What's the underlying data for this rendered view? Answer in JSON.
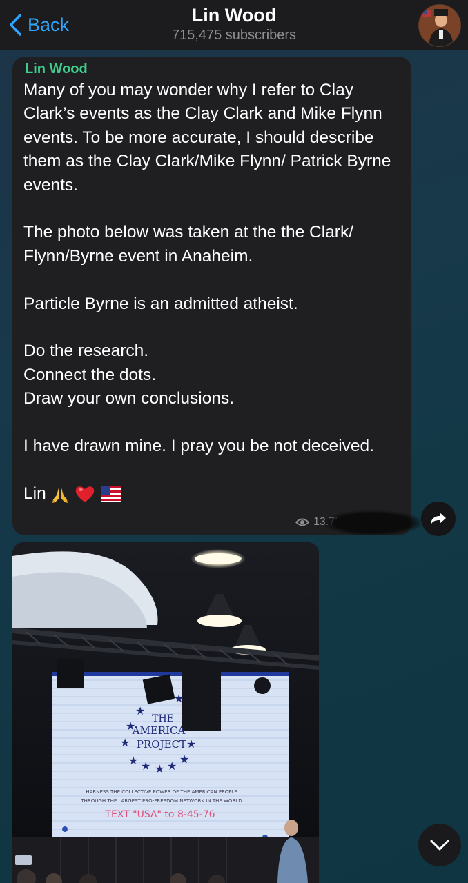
{
  "header": {
    "back_label": "Back",
    "title": "Lin Wood",
    "subtitle": "715,475 subscribers"
  },
  "message": {
    "sender": "Lin Wood",
    "paragraphs": [
      "Many of you may wonder why I refer to Clay Clark’s events as the Clay Clark and Mike Flynn events. To be more accurate, I should describe them as the Clay Clark/Mike Flynn/ Patrick Byrne events.",
      "The photo below was taken at the the Clark/ Flynn/Byrne event in Anaheim.",
      "Particle Byrne is an admitted atheist.",
      "Do the research.\nConnect the dots.\nDraw your own conclusions.",
      "I have drawn mine. I pray you be not deceived."
    ],
    "signature": "Lin",
    "emojis": [
      "praying-hands-icon",
      "red-heart-icon",
      "us-flag-icon"
    ],
    "views": "13.7K"
  },
  "photo": {
    "screen_lines": [
      "THE",
      "AMERICA",
      "PROJECT"
    ],
    "tagline_1": "HARNESS THE COLLECTIVE POWER OF THE AMERICAN PEOPLE",
    "tagline_2": "THROUGH THE LARGEST PRO-FREEDOM NETWORK IN THE WORLD",
    "text_cta": "TEXT \"USA\" to 8-45-76"
  },
  "colors": {
    "accent": "#2ea6ff",
    "sender": "#3fcd8d",
    "bubble": "#1f1f21"
  }
}
